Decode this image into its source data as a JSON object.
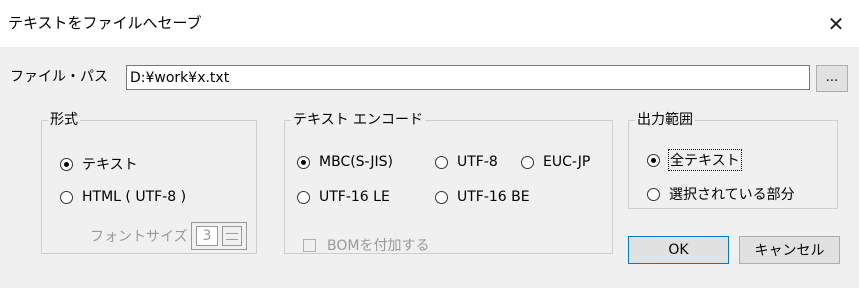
{
  "window": {
    "title": "テキストをファイルへセーブ",
    "close_glyph": "✕"
  },
  "path": {
    "label": "ファイル・パス",
    "value": "D:¥work¥x.txt",
    "browse_label": "..."
  },
  "format": {
    "legend": "形式",
    "option_text": "テキスト",
    "option_html": "HTML ( UTF-8 )",
    "selected": "テキスト",
    "font_size_label": "フォントサイズ",
    "font_size_value": "3"
  },
  "encode": {
    "legend": "テキスト エンコード",
    "options": [
      "MBC(S-JIS)",
      "UTF-8",
      "EUC-JP",
      "UTF-16 LE",
      "UTF-16 BE"
    ],
    "selected": "MBC(S-JIS)",
    "bom_label": "BOMを付加する"
  },
  "range": {
    "legend": "出力範囲",
    "option_all": "全テキスト",
    "option_selection": "選択されている部分",
    "selected": "全テキスト"
  },
  "buttons": {
    "ok": "OK",
    "cancel": "キャンセル"
  }
}
